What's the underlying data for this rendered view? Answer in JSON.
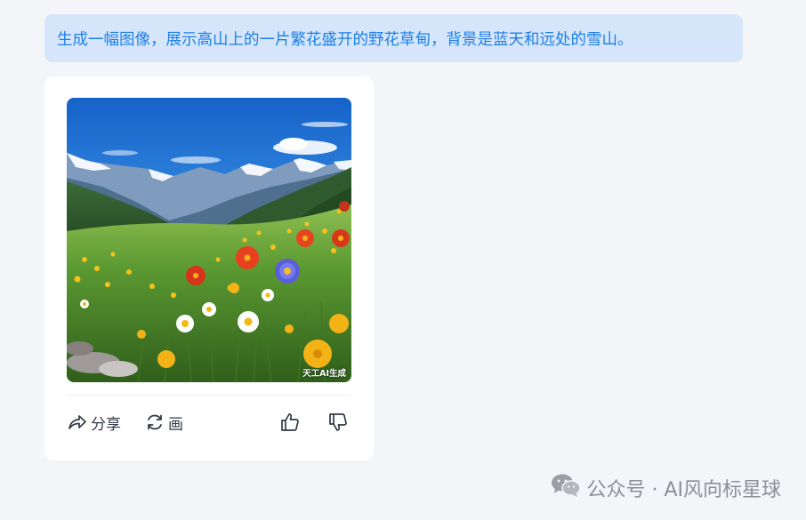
{
  "conversation": {
    "user_prompt": "生成一幅图像，展示高山上的一片繁花盛开的野花草甸，背景是蓝天和远处的雪山。"
  },
  "reply": {
    "image_watermark": "天工AI生成",
    "actions": {
      "share_label": "分享",
      "redraw_label": "画",
      "like_icon": "thumbs-up-icon",
      "dislike_icon": "thumbs-down-icon"
    }
  },
  "footer": {
    "account_text": "公众号 · AI风向标星球",
    "icon": "wechat-icon"
  },
  "colors": {
    "accent": "#1f7fe6",
    "bubble_bg": "#d5e6fb",
    "page_bg": "#f4f5f8",
    "card_bg": "#ffffff"
  }
}
